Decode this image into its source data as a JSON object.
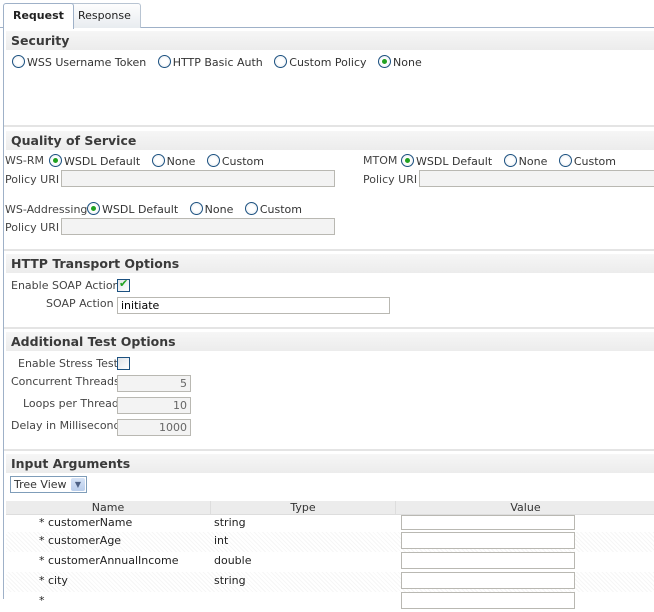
{
  "tabs": [
    {
      "label": "Request",
      "active": true
    },
    {
      "label": "Response",
      "active": false
    }
  ],
  "security": {
    "title": "Security",
    "options": [
      {
        "label": "WSS Username Token",
        "checked": false
      },
      {
        "label": "HTTP Basic Auth",
        "checked": false
      },
      {
        "label": "Custom Policy",
        "checked": false
      },
      {
        "label": "None",
        "checked": true
      }
    ]
  },
  "qos": {
    "title": "Quality of Service",
    "wsrm": {
      "label": "WS-RM",
      "options": [
        {
          "label": "WSDL Default",
          "checked": true
        },
        {
          "label": "None",
          "checked": false
        },
        {
          "label": "Custom",
          "checked": false
        }
      ],
      "policy_label": "Policy URI",
      "policy_value": ""
    },
    "mtom": {
      "label": "MTOM",
      "options": [
        {
          "label": "WSDL Default",
          "checked": true
        },
        {
          "label": "None",
          "checked": false
        },
        {
          "label": "Custom",
          "checked": false
        }
      ],
      "policy_label": "Policy URI",
      "policy_value": ""
    },
    "wsaddr": {
      "label": "WS-Addressing",
      "options": [
        {
          "label": "WSDL Default",
          "checked": true
        },
        {
          "label": "None",
          "checked": false
        },
        {
          "label": "Custom",
          "checked": false
        }
      ],
      "policy_label": "Policy URI",
      "policy_value": ""
    }
  },
  "http": {
    "title": "HTTP Transport Options",
    "enable_soap_label": "Enable SOAP Action",
    "enable_soap_checked": true,
    "soap_action_label": "SOAP Action",
    "soap_action_value": "initiate"
  },
  "test": {
    "title": "Additional Test Options",
    "stress_label": "Enable Stress Test",
    "stress_checked": false,
    "threads_label": "Concurrent Threads",
    "threads_value": "5",
    "loops_label": "Loops per Thread",
    "loops_value": "10",
    "delay_label": "Delay in Milliseconds",
    "delay_value": "1000"
  },
  "args": {
    "title": "Input Arguments",
    "view_select": "Tree View",
    "columns": [
      "Name",
      "Type",
      "Value"
    ],
    "rows": [
      {
        "name": "* customerName",
        "type": "string",
        "value": ""
      },
      {
        "name": "* customerAge",
        "type": "int",
        "value": ""
      },
      {
        "name": "* customerAnnualIncome",
        "type": "double",
        "value": ""
      },
      {
        "name": "* city",
        "type": "string",
        "value": ""
      },
      {
        "name": "*",
        "type": "",
        "value": ""
      }
    ]
  },
  "colors": {
    "accent_green": "#21a121",
    "border_blue": "#1c5180",
    "tab_border": "#9fb1c8"
  }
}
